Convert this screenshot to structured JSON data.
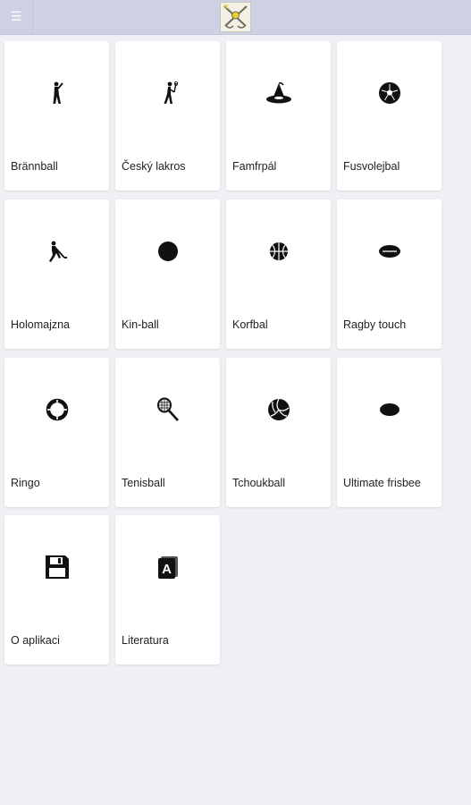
{
  "toolbar": {
    "menu_icon": "hamburger-menu-icon",
    "logo_icon": "crossed-sticks-logo"
  },
  "tiles": [
    {
      "label": "Brännball",
      "icon": "batter-icon"
    },
    {
      "label": "Český lakros",
      "icon": "lacrosse-player-icon"
    },
    {
      "label": "Famfrpál",
      "icon": "witch-hat-icon"
    },
    {
      "label": "Fusvolejbal",
      "icon": "soccer-ball-icon"
    },
    {
      "label": "Holomajzna",
      "icon": "hockey-player-icon"
    },
    {
      "label": "Kin-ball",
      "icon": "ball-icon"
    },
    {
      "label": "Korfbal",
      "icon": "basketball-icon"
    },
    {
      "label": "Ragby touch",
      "icon": "rugby-ball-icon"
    },
    {
      "label": "Ringo",
      "icon": "ring-icon"
    },
    {
      "label": "Tenisball",
      "icon": "tennis-racket-icon"
    },
    {
      "label": "Tchoukball",
      "icon": "volleyball-icon"
    },
    {
      "label": "Ultimate frisbee",
      "icon": "frisbee-icon"
    },
    {
      "label": "O aplikaci",
      "icon": "floppy-disk-icon"
    },
    {
      "label": "Literatura",
      "icon": "letter-a-icon"
    }
  ]
}
